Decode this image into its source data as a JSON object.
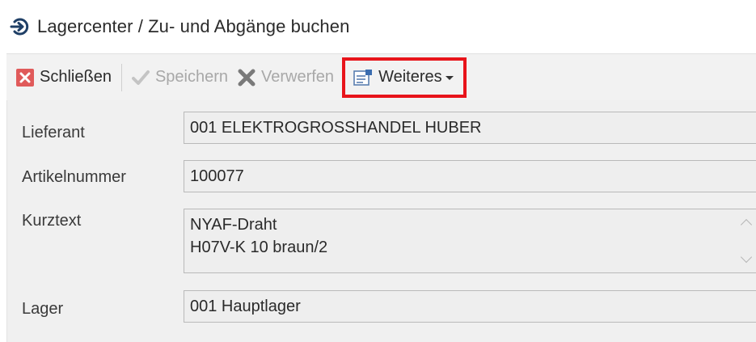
{
  "window": {
    "title": "Lagercenter / Zu- und Abgänge buchen"
  },
  "toolbar": {
    "close_label": "Schließen",
    "save_label": "Speichern",
    "discard_label": "Verwerfen",
    "more_label": "Weiteres"
  },
  "form": {
    "supplier_label": "Lieferant",
    "supplier_value": "001 ELEKTROGROSSHANDEL HUBER",
    "article_label": "Artikelnummer",
    "article_value": "100077",
    "shorttext_label": "Kurztext",
    "shorttext_line1": "NYAF-Draht",
    "shorttext_line2": "H07V-K 10 braun/2",
    "stock_label": "Lager",
    "stock_value": "001 Hauptlager"
  },
  "colors": {
    "highlight": "#e8141b",
    "close_icon": "#e05a5a",
    "title_icon": "#1f3f66"
  }
}
